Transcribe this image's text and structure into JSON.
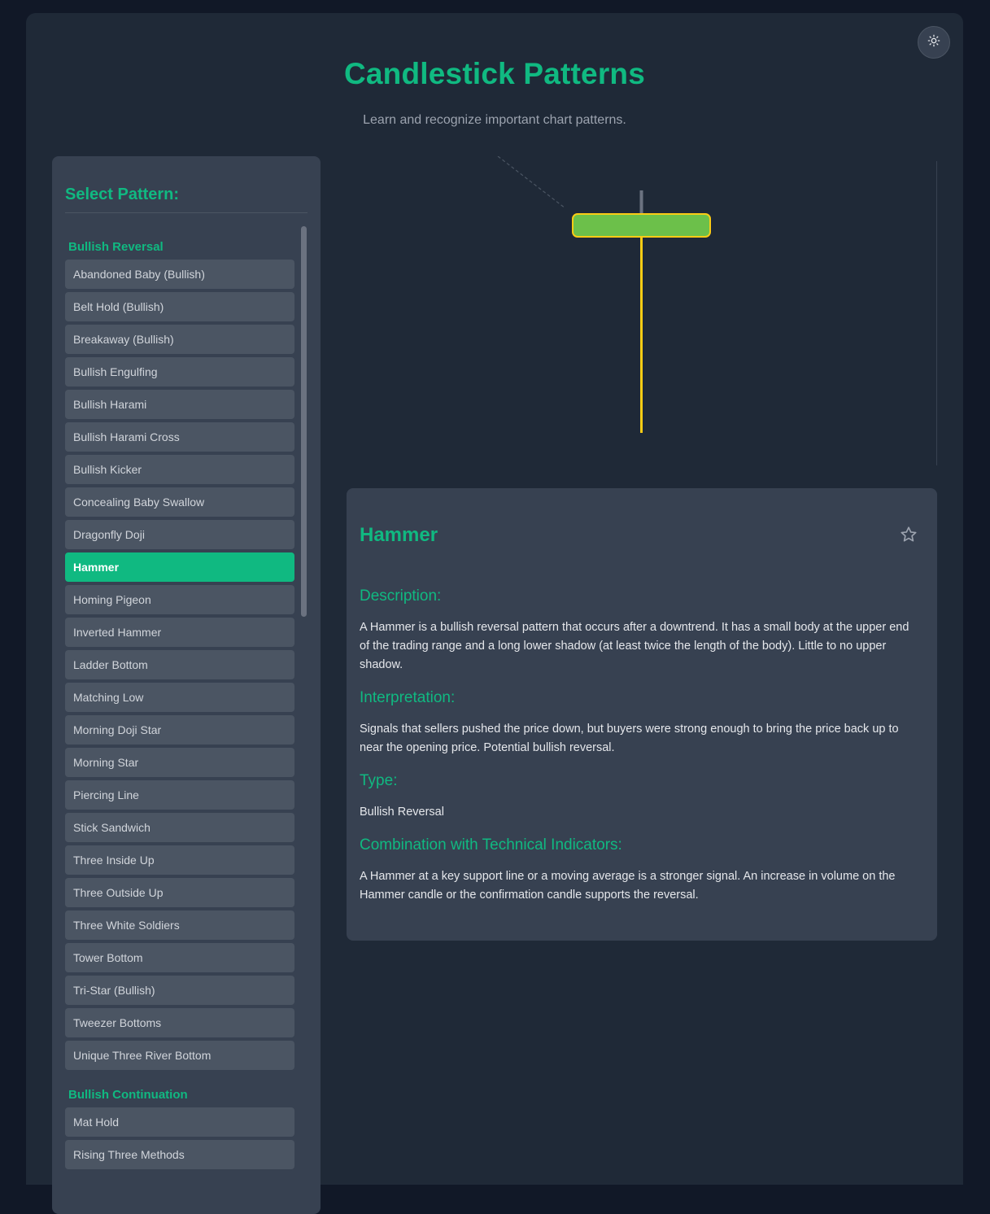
{
  "header": {
    "title": "Candlestick Patterns",
    "subtitle": "Learn and recognize important chart patterns.",
    "theme_toggle_icon": "sun-icon"
  },
  "sidebar": {
    "title": "Select Pattern:",
    "groups": [
      {
        "label": "Bullish Reversal",
        "items": [
          "Abandoned Baby (Bullish)",
          "Belt Hold (Bullish)",
          "Breakaway (Bullish)",
          "Bullish Engulfing",
          "Bullish Harami",
          "Bullish Harami Cross",
          "Bullish Kicker",
          "Concealing Baby Swallow",
          "Dragonfly Doji",
          "Hammer",
          "Homing Pigeon",
          "Inverted Hammer",
          "Ladder Bottom",
          "Matching Low",
          "Morning Doji Star",
          "Morning Star",
          "Piercing Line",
          "Stick Sandwich",
          "Three Inside Up",
          "Three Outside Up",
          "Three White Soldiers",
          "Tower Bottom",
          "Tri-Star (Bullish)",
          "Tweezer Bottoms",
          "Unique Three River Bottom"
        ]
      },
      {
        "label": "Bullish Continuation",
        "items": [
          "Mat Hold",
          "Rising Three Methods"
        ]
      }
    ],
    "selected": "Hammer"
  },
  "chart": {
    "candle": {
      "type": "bullish",
      "body_color": "#6cc04a",
      "outline_color": "#facc15",
      "shadow_color": "#facc15",
      "upper_wick_color": "#6b7280"
    },
    "trend_line_color": "#4b5563"
  },
  "details": {
    "name": "Hammer",
    "favorite_icon": "star-icon",
    "sections": [
      {
        "heading": "Description:",
        "text": "A Hammer is a bullish reversal pattern that occurs after a downtrend. It has a small body at the upper end of the trading range and a long lower shadow (at least twice the length of the body). Little to no upper shadow."
      },
      {
        "heading": "Interpretation:",
        "text": "Signals that sellers pushed the price down, but buyers were strong enough to bring the price back up to near the opening price. Potential bullish reversal."
      },
      {
        "heading": "Type:",
        "text": "Bullish Reversal"
      },
      {
        "heading": "Combination with Technical Indicators:",
        "text": "A Hammer at a key support line or a moving average is a stronger signal. An increase in volume on the Hammer candle or the confirmation candle supports the reversal."
      }
    ]
  },
  "colors": {
    "background": "#111827",
    "panel": "#1f2937",
    "card": "#374151",
    "accent": "#10b981",
    "button": "#4b5563"
  }
}
